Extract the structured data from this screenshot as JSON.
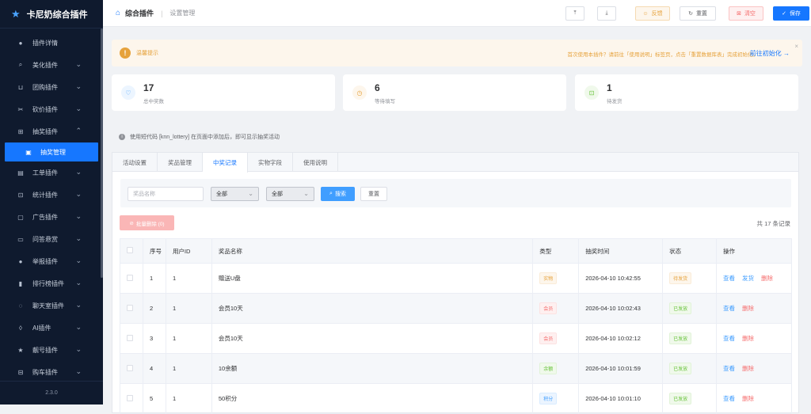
{
  "app": {
    "title": "卡尼奶综合插件",
    "version": "2.3.0"
  },
  "sidebar": {
    "items": [
      {
        "label": "插件详情",
        "icon": "info-icon",
        "glyph": "●",
        "chevron": false
      },
      {
        "label": "美化插件",
        "icon": "brush-icon",
        "glyph": "⌕",
        "chevron": true
      },
      {
        "label": "团购插件",
        "icon": "cart-icon",
        "glyph": "⊔",
        "chevron": true
      },
      {
        "label": "砍价插件",
        "icon": "scissors-icon",
        "glyph": "✂",
        "chevron": true
      },
      {
        "label": "抽奖插件",
        "icon": "gift-icon",
        "glyph": "⊞",
        "chevron": true,
        "expanded": true
      },
      {
        "label": "抽奖管理",
        "icon": "chart-icon",
        "glyph": "▣",
        "active": true
      },
      {
        "label": "工单插件",
        "icon": "ticket-icon",
        "glyph": "▤",
        "chevron": true
      },
      {
        "label": "统计插件",
        "icon": "stats-icon",
        "glyph": "⊡",
        "chevron": true
      },
      {
        "label": "广告插件",
        "icon": "ad-icon",
        "glyph": "▢",
        "chevron": true
      },
      {
        "label": "问答悬赏",
        "icon": "qa-icon",
        "glyph": "▭",
        "chevron": true
      },
      {
        "label": "举报插件",
        "icon": "report-icon",
        "glyph": "●",
        "chevron": true
      },
      {
        "label": "排行榜插件",
        "icon": "rank-icon",
        "glyph": "▮",
        "chevron": true
      },
      {
        "label": "聊天室插件",
        "icon": "chat-icon",
        "glyph": "◌",
        "chevron": true
      },
      {
        "label": "AI插件",
        "icon": "ai-icon",
        "glyph": "◊",
        "chevron": true
      },
      {
        "label": "靓号插件",
        "icon": "star-icon",
        "glyph": "★",
        "chevron": true
      },
      {
        "label": "购车插件",
        "icon": "car-icon",
        "glyph": "⊟",
        "chevron": true
      }
    ]
  },
  "topbar": {
    "crumb_main": "综合插件",
    "crumb_sub": "设置管理",
    "export_icon": "upload-icon",
    "import_icon": "download-icon",
    "feedback": "反馈",
    "reset": "重置",
    "clear": "清空",
    "save": "保存"
  },
  "notice": {
    "title": "温馨提示",
    "message": "首次使用本插件？请前往「使用说明」标签页，点击「重置数据库表」完成初始化。",
    "link": "前往初始化 →"
  },
  "stats": [
    {
      "value": "17",
      "label": "总中奖数",
      "icon": "trophy-icon",
      "glyph": "♡",
      "color": "#409eff",
      "bg": "#ecf5ff"
    },
    {
      "value": "6",
      "label": "等待填写",
      "icon": "clock-icon",
      "glyph": "◷",
      "color": "#e6a23c",
      "bg": "#fdf6ec"
    },
    {
      "value": "1",
      "label": "待发货",
      "icon": "package-icon",
      "glyph": "⊡",
      "color": "#67c23a",
      "bg": "#f0f9eb"
    }
  ],
  "hint": "使用短代码 [knn_lottery] 在页面中添加后，即可显示抽奖活动",
  "tabs": [
    {
      "label": "活动设置"
    },
    {
      "label": "奖品管理"
    },
    {
      "label": "中奖记录",
      "active": true
    },
    {
      "label": "实物字段"
    },
    {
      "label": "使用说明"
    }
  ],
  "filter": {
    "prize_placeholder": "奖品名称",
    "type_value": "全部",
    "status_value": "全部",
    "search": "搜索",
    "reset": "重置"
  },
  "bulk_delete": "批量删除 (0)",
  "total": "共 17 条记录",
  "table": {
    "headers": [
      "序号",
      "用户ID",
      "奖品名称",
      "类型",
      "抽奖时间",
      "状态",
      "操作"
    ],
    "rows": [
      {
        "no": "1",
        "uid": "1",
        "prize": "赠送U盘",
        "type": "实物",
        "type_style": "t-orange",
        "time": "2026-04-10 10:42:55",
        "status": "待发货",
        "status_style": "t-orange",
        "ops": [
          "查看",
          "发货",
          "删除"
        ]
      },
      {
        "no": "2",
        "uid": "1",
        "prize": "会员10天",
        "type": "会员",
        "type_style": "t-red",
        "time": "2026-04-10 10:02:43",
        "status": "已发放",
        "status_style": "t-green",
        "ops": [
          "查看",
          "删除"
        ]
      },
      {
        "no": "3",
        "uid": "1",
        "prize": "会员10天",
        "type": "会员",
        "type_style": "t-red",
        "time": "2026-04-10 10:02:12",
        "status": "已发放",
        "status_style": "t-green",
        "ops": [
          "查看",
          "删除"
        ]
      },
      {
        "no": "4",
        "uid": "1",
        "prize": "10余额",
        "type": "余额",
        "type_style": "t-green",
        "time": "2026-04-10 10:01:59",
        "status": "已发放",
        "status_style": "t-green",
        "ops": [
          "查看",
          "删除"
        ]
      },
      {
        "no": "5",
        "uid": "1",
        "prize": "50积分",
        "type": "积分",
        "type_style": "t-blue",
        "time": "2026-04-10 10:01:10",
        "status": "已发放",
        "status_style": "t-green",
        "ops": [
          "查看",
          "删除"
        ]
      }
    ]
  }
}
